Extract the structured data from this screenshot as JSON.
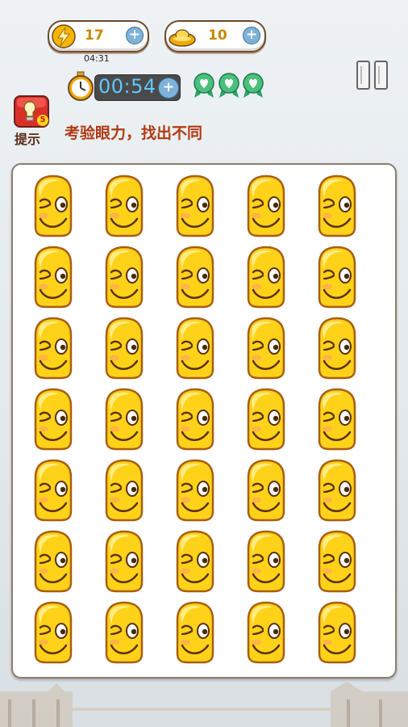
{
  "energy": {
    "value": "17"
  },
  "gold": {
    "value": "10"
  },
  "clock": {
    "time": "04:31"
  },
  "timer": {
    "value": "00:54"
  },
  "hint": {
    "label": "提示",
    "count": "5"
  },
  "instruction": "考验眼力，找出不同",
  "lives": {
    "count": 3,
    "icons": [
      "heart-badge-icon",
      "heart-badge-icon",
      "heart-badge-icon"
    ]
  },
  "colors": {
    "board_bg": "#ffffff",
    "face_yellow": "#ffd21a",
    "face_outline": "#a85e12",
    "hint_red": "#d9302a"
  },
  "grid": {
    "rows": 7,
    "cols": 5
  }
}
